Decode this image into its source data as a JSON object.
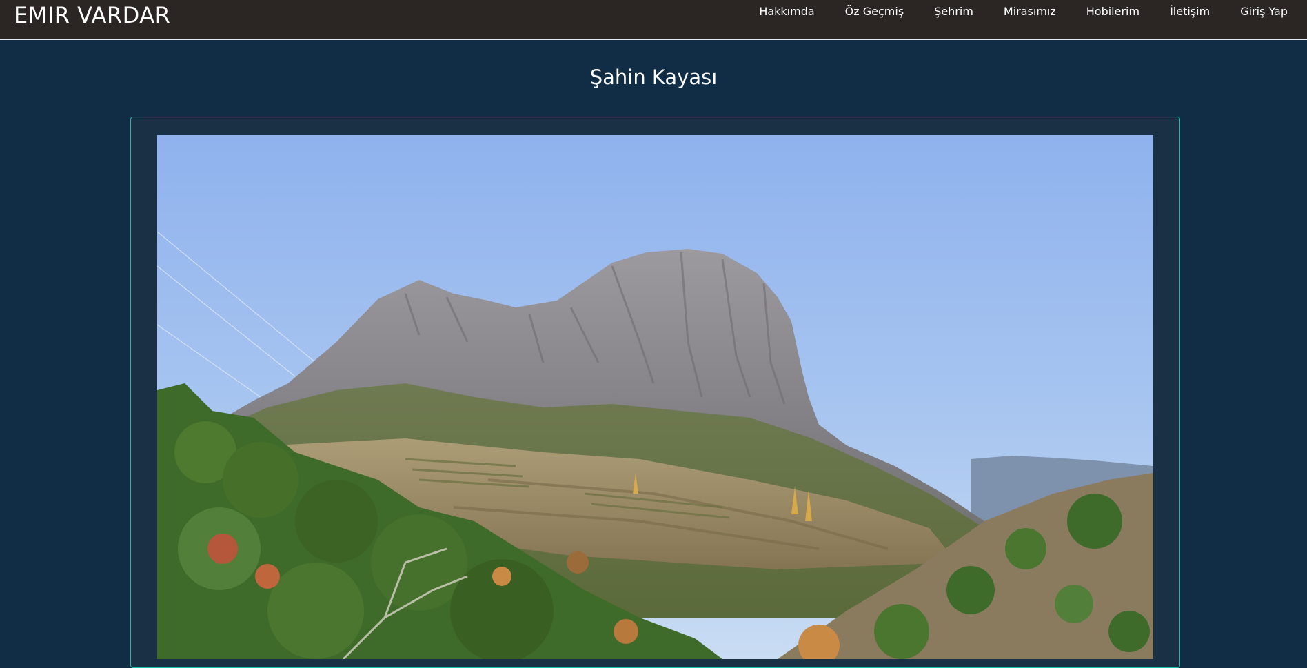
{
  "header": {
    "brand": "EMIR VARDAR",
    "nav": [
      "Hakkımda",
      "Öz Geçmiş",
      "Şehrim",
      "Mirasımız",
      "Hobilerim",
      "İletişim",
      "Giriş Yap"
    ]
  },
  "main": {
    "title": "Şahin Kayası"
  },
  "colors": {
    "navbar_bg": "#2b2523",
    "page_bg": "#112d45",
    "card_border": "#18c0a9"
  }
}
